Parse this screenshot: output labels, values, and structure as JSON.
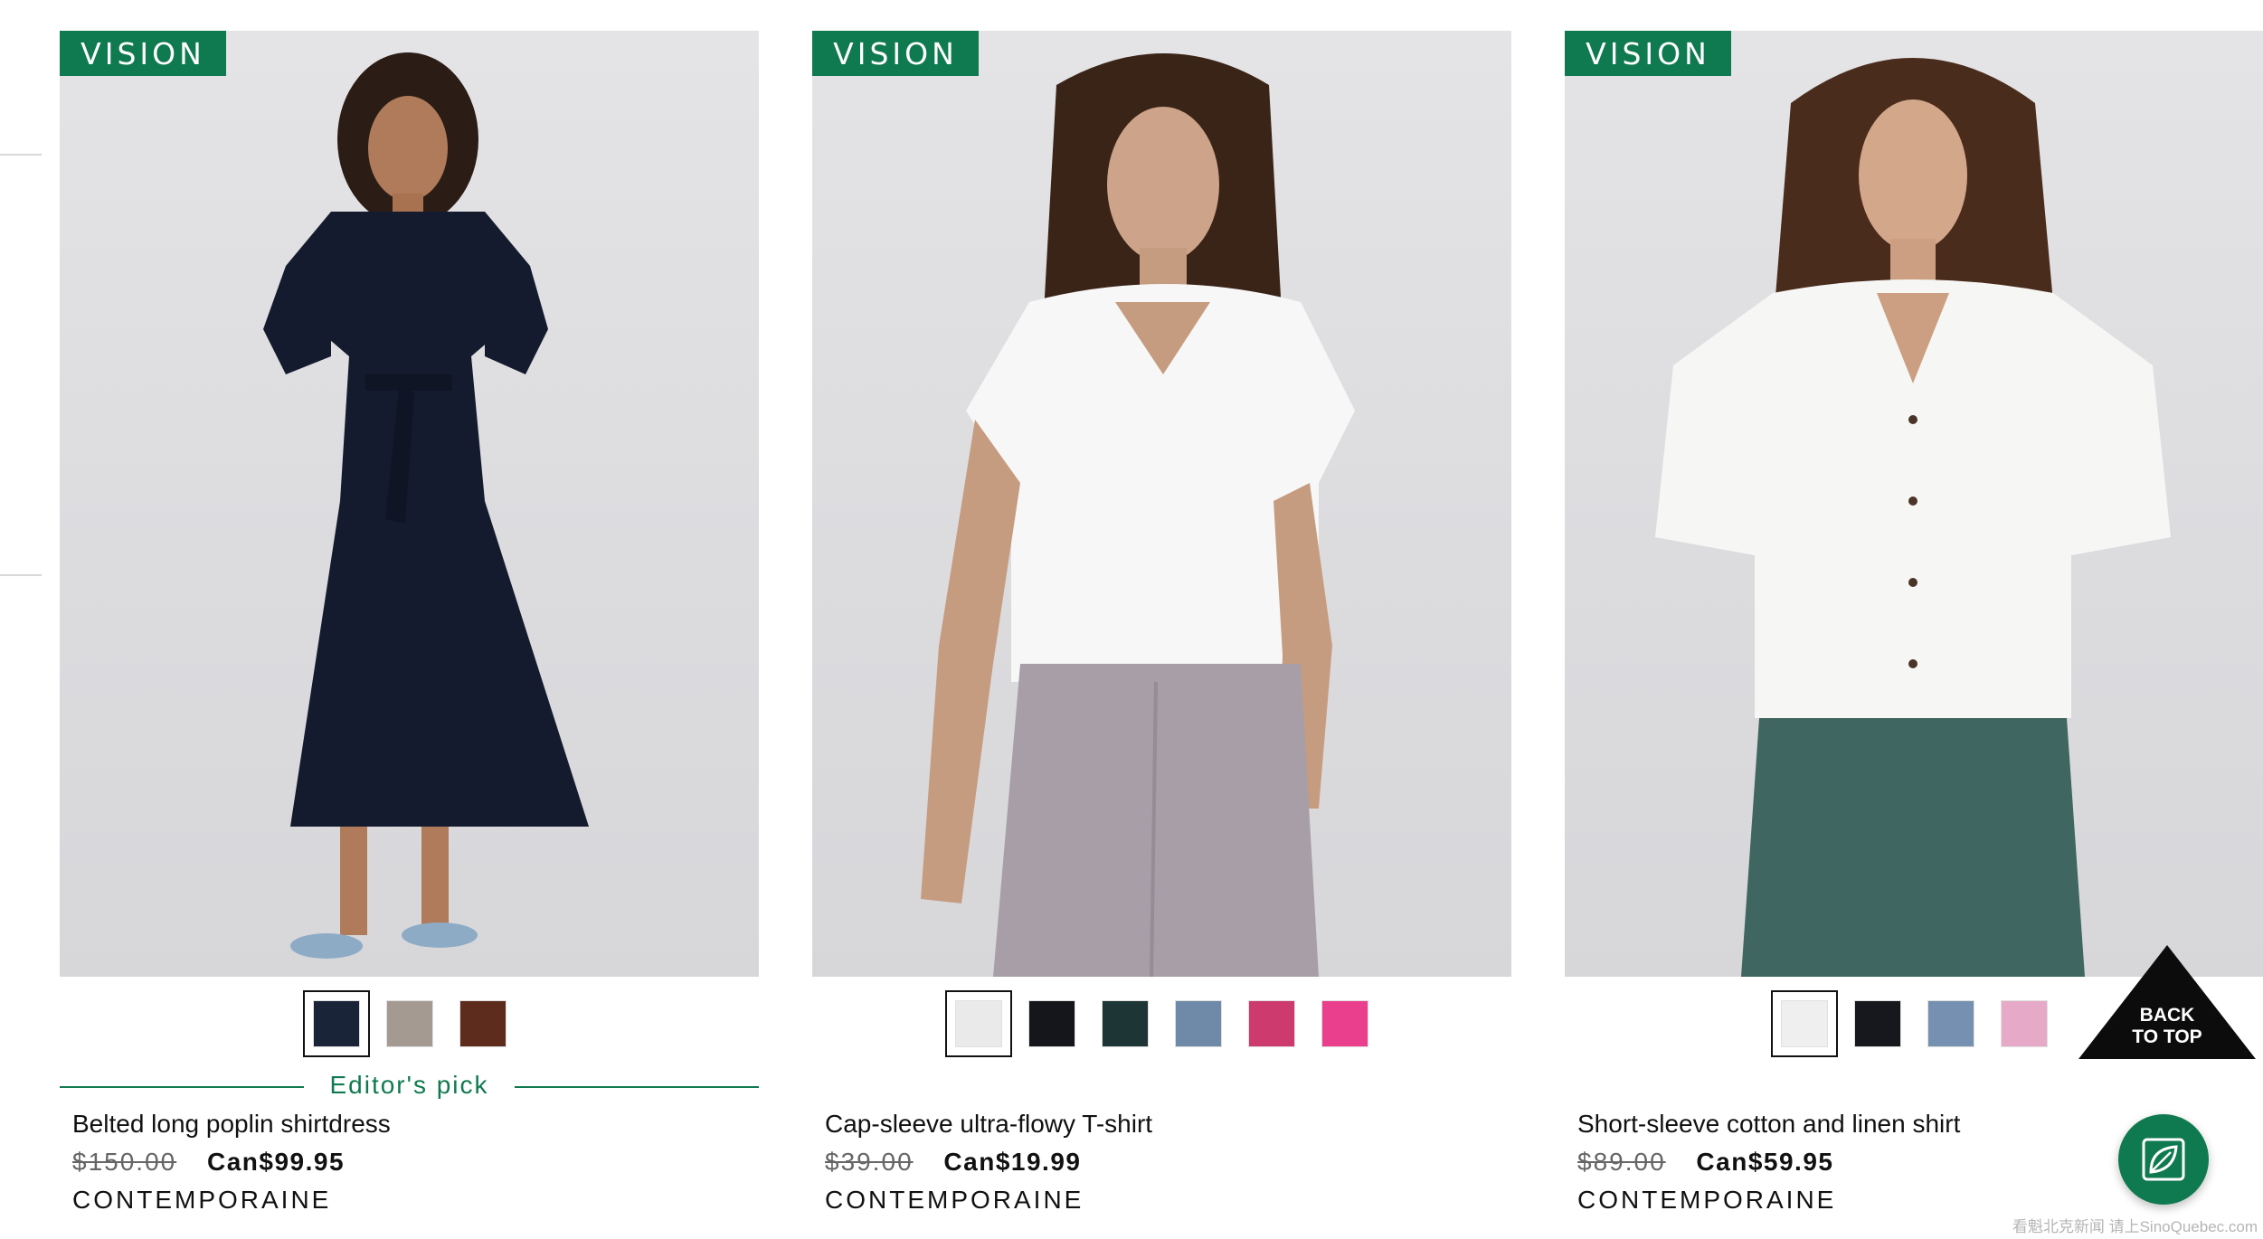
{
  "products": [
    {
      "badge": "VISION",
      "image_alt": "Belted long poplin shirtdress",
      "swatches": [
        {
          "color": "#1a2438",
          "selected": true
        },
        {
          "color": "#a59a92",
          "selected": false
        },
        {
          "color": "#5e2c1c",
          "selected": false
        }
      ],
      "editor_pick": "Editor's pick",
      "name": "Belted long poplin shirtdress",
      "old_price": "$150.00",
      "new_price": "Can$99.95",
      "brand": "CONTEMPORAINE"
    },
    {
      "badge": "VISION",
      "image_alt": "Cap-sleeve ultra-flowy T-shirt",
      "swatches": [
        {
          "color": "#eaeaea",
          "selected": true
        },
        {
          "color": "#15151c",
          "selected": false
        },
        {
          "color": "#1e3535",
          "selected": false
        },
        {
          "color": "#6f89a8",
          "selected": false
        },
        {
          "color": "#cc3a6e",
          "selected": false
        },
        {
          "color": "#ea3f8d",
          "selected": false
        }
      ],
      "name": "Cap-sleeve ultra-flowy T-shirt",
      "old_price": "$39.00",
      "new_price": "Can$19.99",
      "brand": "CONTEMPORAINE"
    },
    {
      "badge": "VISION",
      "image_alt": "Short-sleeve cotton and linen shirt",
      "swatches": [
        {
          "color": "#efefef",
          "selected": true
        },
        {
          "color": "#17171e",
          "selected": false
        },
        {
          "color": "#7590b0",
          "selected": false
        },
        {
          "color": "#e6aac8",
          "selected": false
        }
      ],
      "name": "Short-sleeve cotton and linen shirt",
      "old_price": "$89.00",
      "new_price": "Can$59.95",
      "brand": "CONTEMPORAINE"
    }
  ],
  "back_to_top": {
    "line1": "BACK",
    "line2": "TO TOP"
  },
  "fab": {
    "icon": "leaf-icon"
  },
  "watermark": "看魁北克新闻 请上SinoQuebec.com",
  "colors": {
    "accent_green": "#0f7a4f",
    "back_to_top_bg": "#0c0c0c"
  }
}
